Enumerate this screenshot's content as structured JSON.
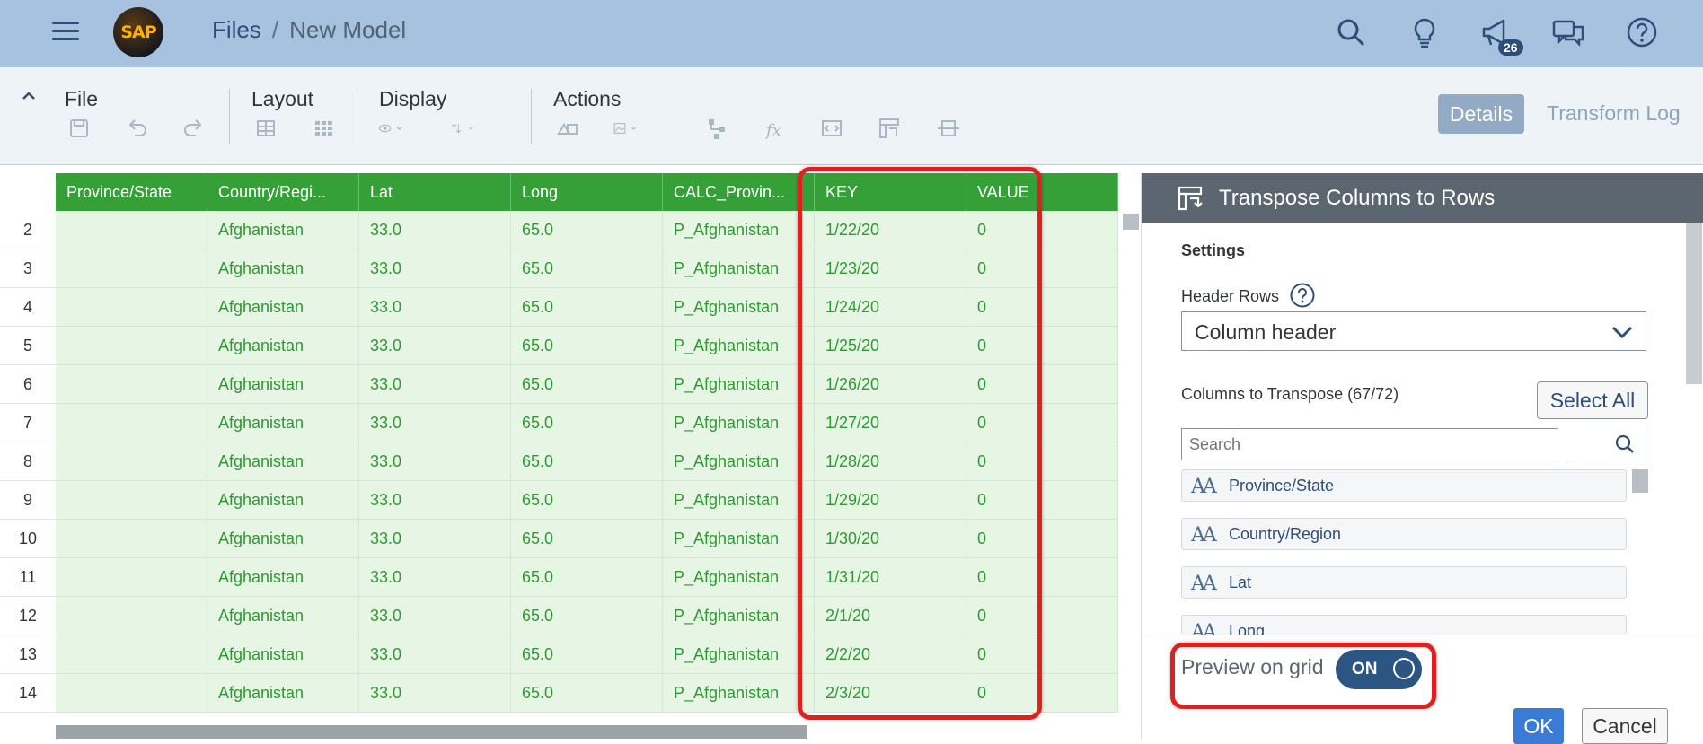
{
  "shell": {
    "breadcrumb_root": "Files",
    "breadcrumb_sep": "/",
    "breadcrumb_current": "New Model",
    "logo_text": "SAP",
    "notification_count": "26"
  },
  "toolbar": {
    "file_label": "File",
    "layout_label": "Layout",
    "display_label": "Display",
    "actions_label": "Actions",
    "details_label": "Details",
    "transform_log_label": "Transform Log"
  },
  "grid": {
    "columns": [
      "Province/State",
      "Country/Regi...",
      "Lat",
      "Long",
      "CALC_Provin...",
      "KEY",
      "VALUE"
    ],
    "rows": [
      {
        "n": "2",
        "cells": [
          "",
          "Afghanistan",
          "33.0",
          "65.0",
          "P_Afghanistan",
          "1/22/20",
          "0"
        ]
      },
      {
        "n": "3",
        "cells": [
          "",
          "Afghanistan",
          "33.0",
          "65.0",
          "P_Afghanistan",
          "1/23/20",
          "0"
        ]
      },
      {
        "n": "4",
        "cells": [
          "",
          "Afghanistan",
          "33.0",
          "65.0",
          "P_Afghanistan",
          "1/24/20",
          "0"
        ]
      },
      {
        "n": "5",
        "cells": [
          "",
          "Afghanistan",
          "33.0",
          "65.0",
          "P_Afghanistan",
          "1/25/20",
          "0"
        ]
      },
      {
        "n": "6",
        "cells": [
          "",
          "Afghanistan",
          "33.0",
          "65.0",
          "P_Afghanistan",
          "1/26/20",
          "0"
        ]
      },
      {
        "n": "7",
        "cells": [
          "",
          "Afghanistan",
          "33.0",
          "65.0",
          "P_Afghanistan",
          "1/27/20",
          "0"
        ]
      },
      {
        "n": "8",
        "cells": [
          "",
          "Afghanistan",
          "33.0",
          "65.0",
          "P_Afghanistan",
          "1/28/20",
          "0"
        ]
      },
      {
        "n": "9",
        "cells": [
          "",
          "Afghanistan",
          "33.0",
          "65.0",
          "P_Afghanistan",
          "1/29/20",
          "0"
        ]
      },
      {
        "n": "10",
        "cells": [
          "",
          "Afghanistan",
          "33.0",
          "65.0",
          "P_Afghanistan",
          "1/30/20",
          "0"
        ]
      },
      {
        "n": "11",
        "cells": [
          "",
          "Afghanistan",
          "33.0",
          "65.0",
          "P_Afghanistan",
          "1/31/20",
          "0"
        ]
      },
      {
        "n": "12",
        "cells": [
          "",
          "Afghanistan",
          "33.0",
          "65.0",
          "P_Afghanistan",
          "2/1/20",
          "0"
        ]
      },
      {
        "n": "13",
        "cells": [
          "",
          "Afghanistan",
          "33.0",
          "65.0",
          "P_Afghanistan",
          "2/2/20",
          "0"
        ]
      },
      {
        "n": "14",
        "cells": [
          "",
          "Afghanistan",
          "33.0",
          "65.0",
          "P_Afghanistan",
          "2/3/20",
          "0"
        ]
      }
    ]
  },
  "panel": {
    "title": "Transpose Columns to Rows",
    "settings_label": "Settings",
    "header_rows_label": "Header Rows",
    "header_rows_value": "Column header",
    "columns_to_transpose_label": "Columns to Transpose (67/72)",
    "select_all_label": "Select All",
    "search_placeholder": "Search",
    "column_items": [
      "Province/State",
      "Country/Region",
      "Lat",
      "Long"
    ],
    "preview_label": "Preview on grid",
    "preview_toggle": "ON",
    "ok_label": "OK",
    "cancel_label": "Cancel"
  },
  "colors": {
    "shell_bg": "#a7c2de",
    "grid_header": "#36a038",
    "grid_text": "#2f9a32",
    "grid_cell_bg": "#e6f5e4",
    "highlight": "#e0201e",
    "toggle_on": "#2c5584"
  }
}
